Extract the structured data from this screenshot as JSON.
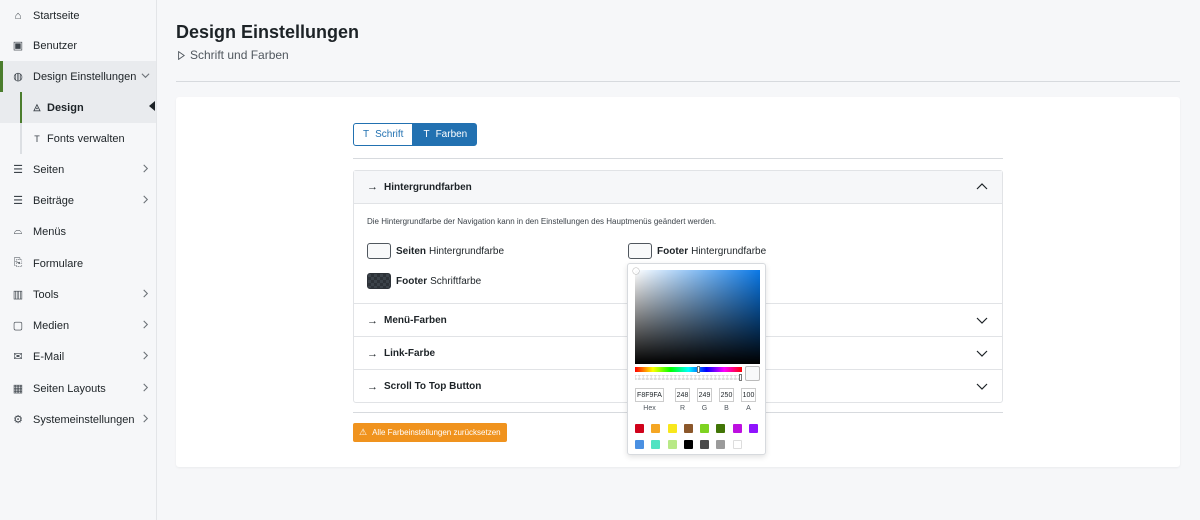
{
  "sidebar": {
    "items": [
      {
        "label": "Startseite",
        "icon": "home-icon",
        "glyph": "⌂",
        "chevron": false
      },
      {
        "label": "Benutzer",
        "icon": "user-card-icon",
        "glyph": "▣",
        "chevron": false
      },
      {
        "label": "Design Einstellungen",
        "icon": "palette-icon",
        "glyph": "◍",
        "chevron": true
      },
      {
        "label": "Design",
        "icon": "brush-icon",
        "glyph": "◬",
        "chevron": false
      },
      {
        "label": "Fonts verwalten",
        "icon": "font-icon",
        "glyph": "T",
        "chevron": false
      },
      {
        "label": "Seiten",
        "icon": "pages-icon",
        "glyph": "☰",
        "chevron": true
      },
      {
        "label": "Beiträge",
        "icon": "posts-icon",
        "glyph": "☰",
        "chevron": true
      },
      {
        "label": "Menüs",
        "icon": "menu-icon",
        "glyph": "⌓",
        "chevron": false
      },
      {
        "label": "Formulare",
        "icon": "forms-icon",
        "glyph": "⎘",
        "chevron": false
      },
      {
        "label": "Tools",
        "icon": "tools-icon",
        "glyph": "▥",
        "chevron": true
      },
      {
        "label": "Medien",
        "icon": "media-icon",
        "glyph": "▢",
        "chevron": true
      },
      {
        "label": "E-Mail",
        "icon": "mail-icon",
        "glyph": "✉",
        "chevron": true
      },
      {
        "label": "Seiten Layouts",
        "icon": "layouts-icon",
        "glyph": "▦",
        "chevron": true
      },
      {
        "label": "Systemeinstellungen",
        "icon": "settings-icon",
        "glyph": "⚙",
        "chevron": true
      }
    ]
  },
  "header": {
    "title": "Design Einstellungen",
    "subtitle": "Schrift und Farben"
  },
  "tabs": [
    {
      "label": "Schrift",
      "active": false
    },
    {
      "label": "Farben",
      "active": true
    }
  ],
  "sections": {
    "background": {
      "title": "Hintergrundfarben",
      "hint": "Die Hintergrundfarbe der Navigation kann in den Einstellungen des Hauptmenüs geändert werden.",
      "page_bg_bold": "Seiten",
      "page_bg_rest": "Hintergrundfarbe",
      "footer_bg_bold": "Footer",
      "footer_bg_rest": "Hintergrundfarbe",
      "footer_font_bold": "Footer",
      "footer_font_rest": "Schriftfarbe"
    },
    "menu": {
      "title": "Menü-Farben"
    },
    "link": {
      "title": "Link-Farbe"
    },
    "scroll": {
      "title": "Scroll To Top Button"
    }
  },
  "reset_button": "Alle Farbeinstellungen zurücksetzen",
  "color_picker": {
    "hex": "F8F9FA",
    "r": "248",
    "g": "249",
    "b": "250",
    "a": "100",
    "labels": {
      "hex": "Hex",
      "r": "R",
      "g": "G",
      "b": "B",
      "a": "A"
    },
    "presets": [
      "#d0021b",
      "#f5a623",
      "#f8e71c",
      "#8b572a",
      "#7ed321",
      "#417505",
      "#bd10e0",
      "#9013fe",
      "#4a90e2",
      "#50e3c2",
      "#b8e986",
      "#000000",
      "#4a4a4a",
      "#9b9b9b",
      "#ffffff"
    ]
  },
  "colors": {
    "accent": "#2271b1",
    "active_marker": "#4b7d2d",
    "warning": "#f0931e"
  }
}
